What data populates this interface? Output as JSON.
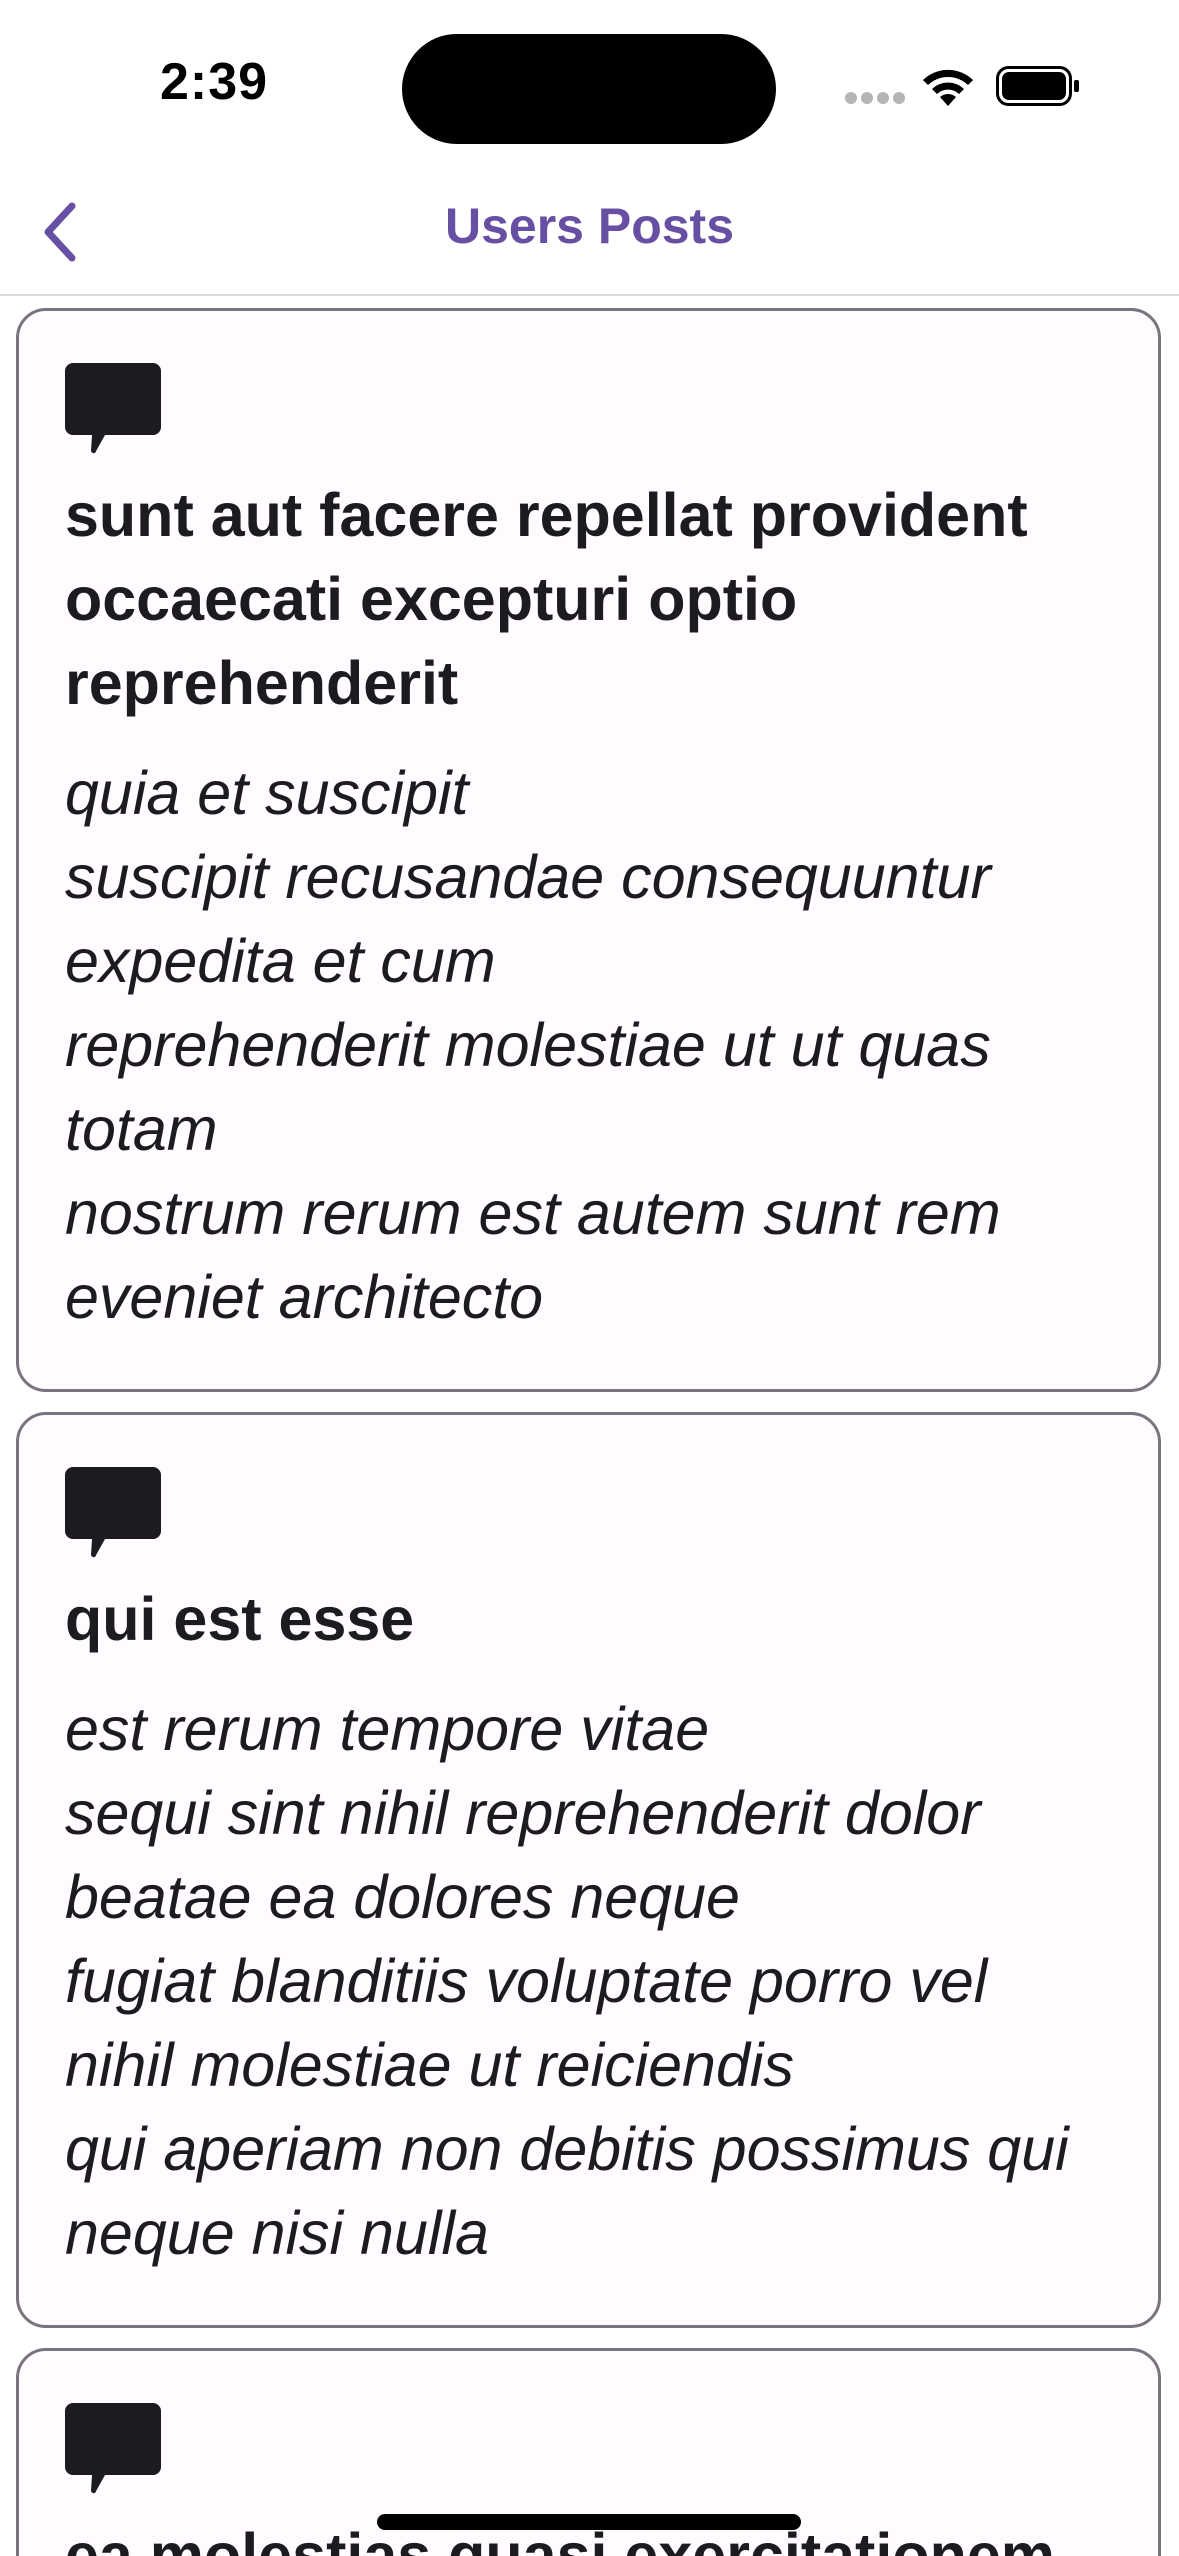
{
  "status_bar": {
    "time": "2:39"
  },
  "nav": {
    "title": "Users Posts",
    "back_icon": "chevron-left-icon",
    "accent_color": "#6750a4"
  },
  "posts": [
    {
      "icon": "comment-icon",
      "title": "sunt aut facere repellat provident occaecati excepturi optio reprehenderit",
      "body": "quia et suscipit\nsuscipit recusandae consequuntur expedita et cum\nreprehenderit molestiae ut ut quas totam\nnostrum rerum est autem sunt rem eveniet architecto"
    },
    {
      "icon": "comment-icon",
      "title": "qui est esse",
      "body": "est rerum tempore vitae\nsequi sint nihil reprehenderit dolor beatae ea dolores neque\nfugiat blanditiis voluptate porro vel nihil molestiae ut reiciendis\nqui aperiam non debitis possimus qui neque nisi nulla"
    },
    {
      "icon": "comment-icon",
      "title": "ea molestias quasi exercitationem",
      "body": ""
    }
  ]
}
